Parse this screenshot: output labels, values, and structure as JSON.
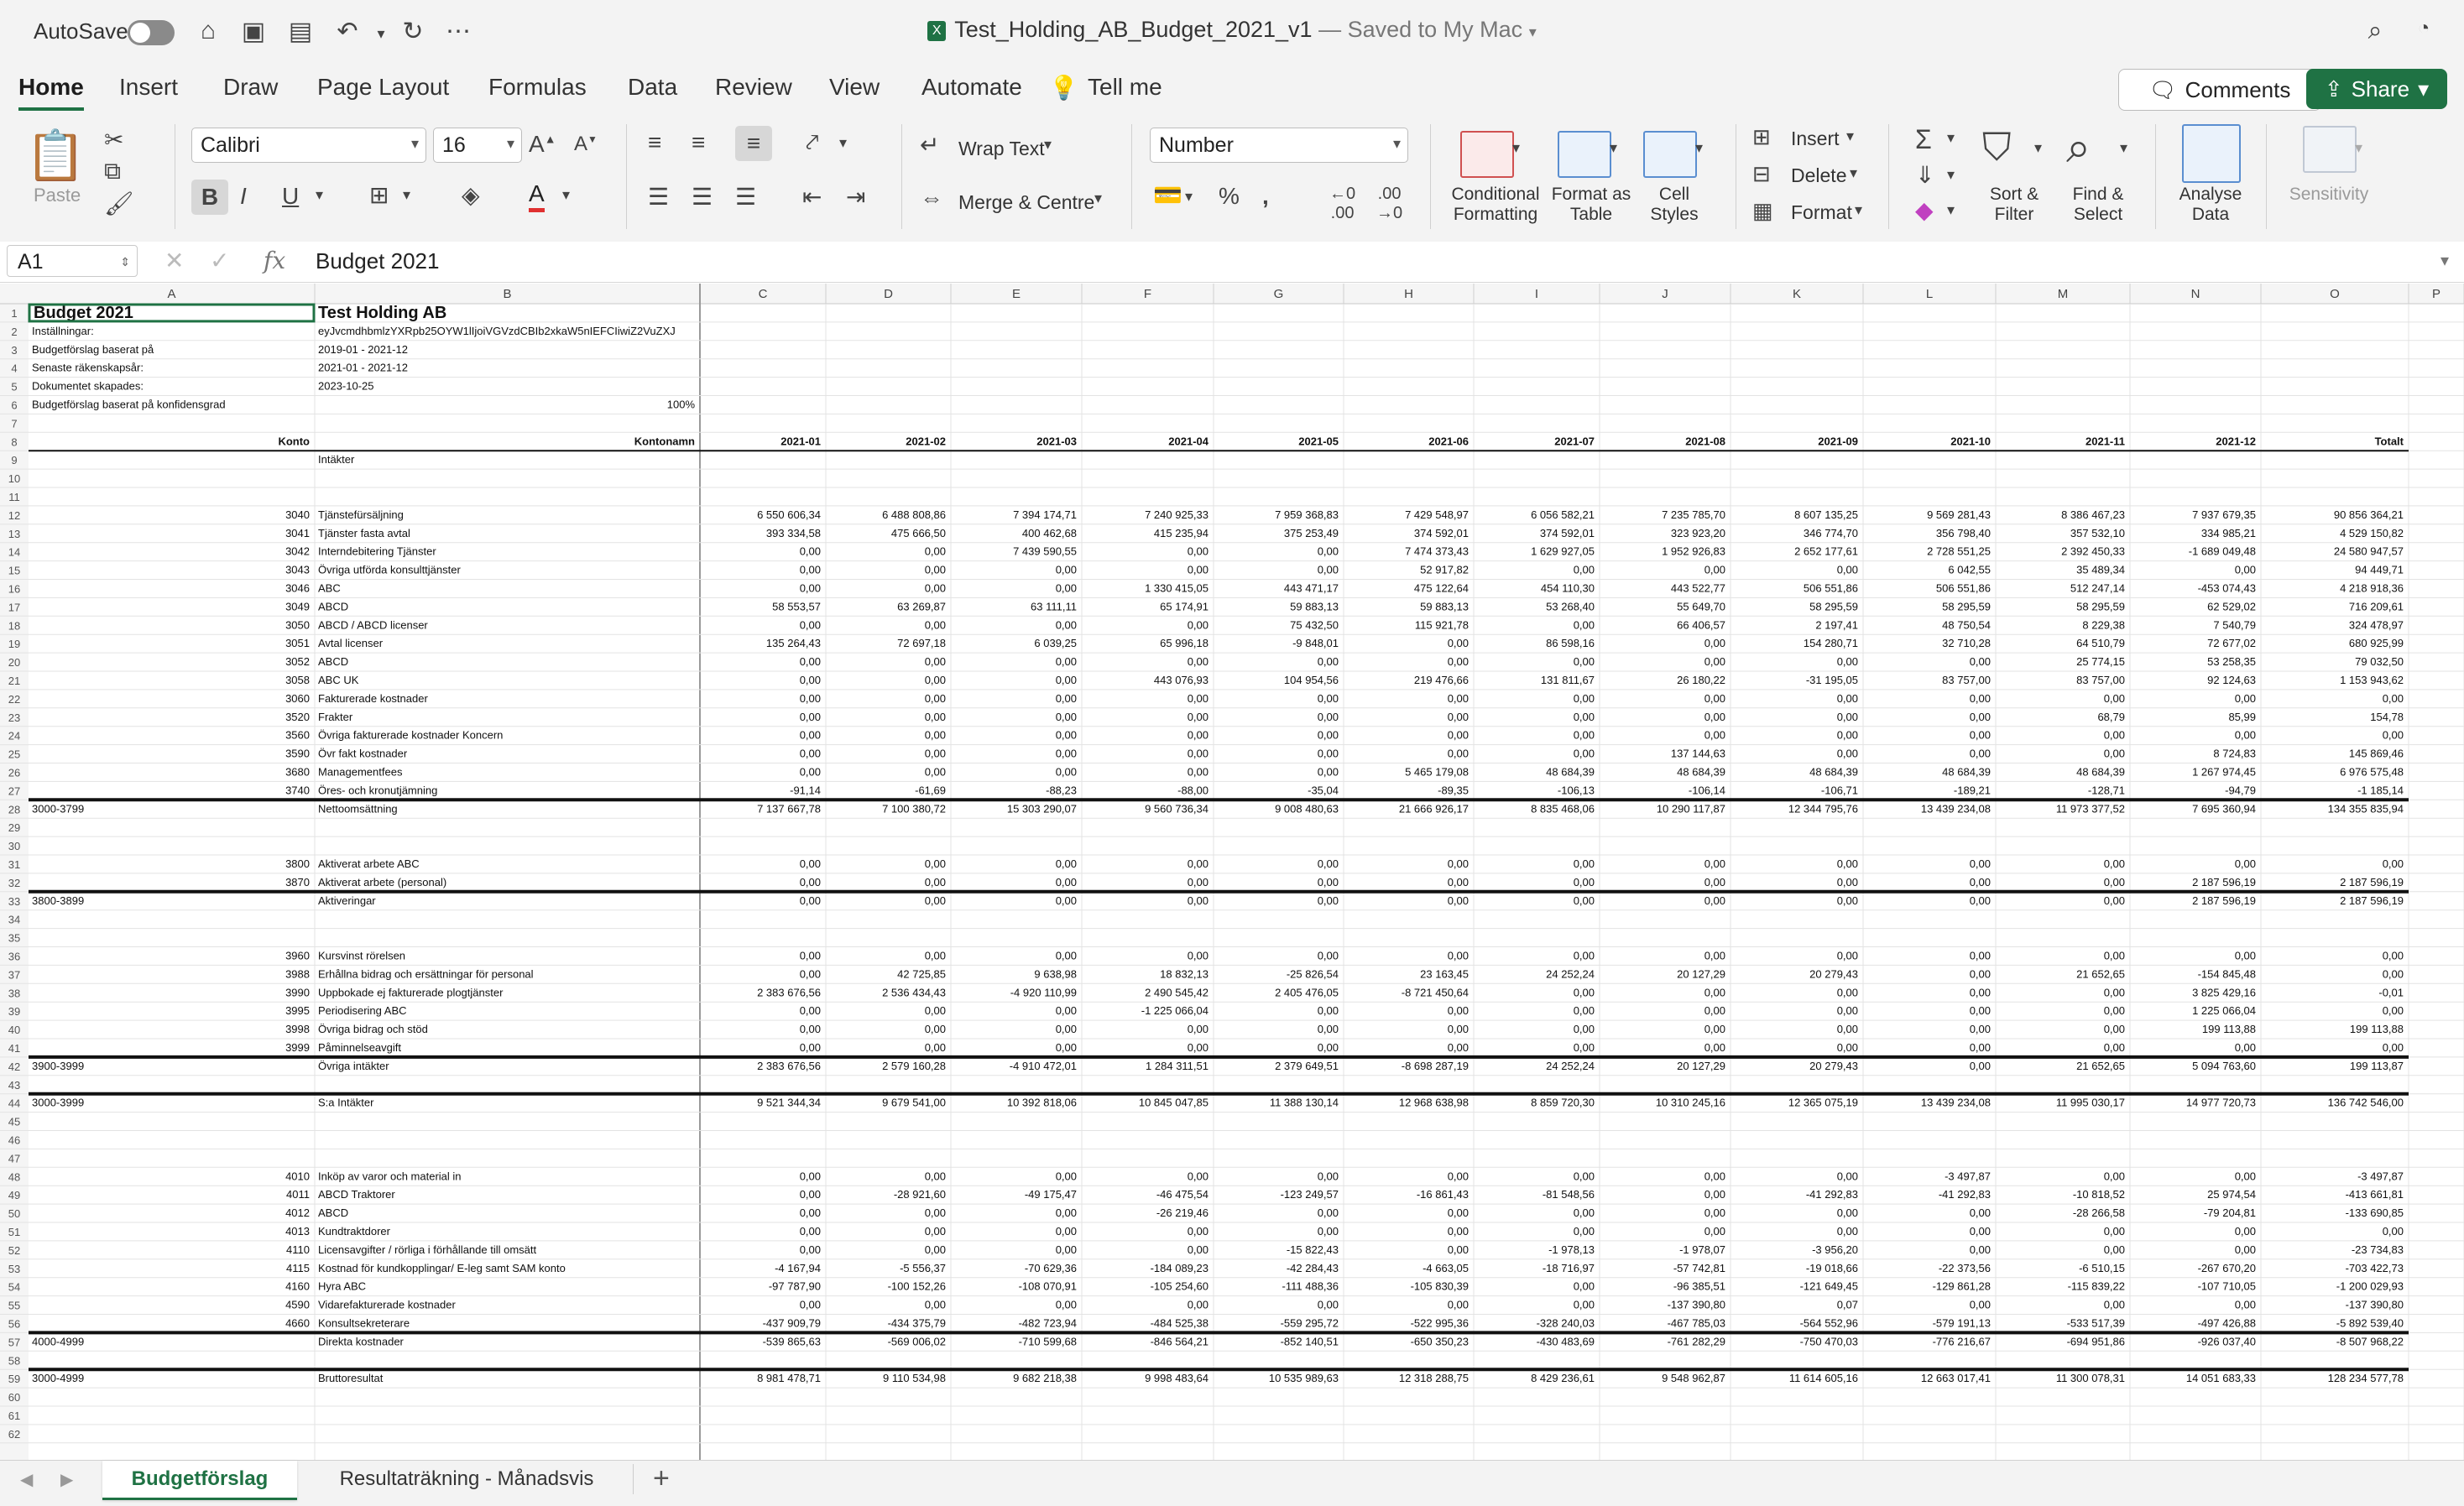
{
  "window": {
    "autosave_label": "AutoSave",
    "title": "Test_Holding_AB_Budget_2021_v1",
    "saved_status": "— Saved to My Mac"
  },
  "menu_tabs": [
    "Home",
    "Insert",
    "Draw",
    "Page Layout",
    "Formulas",
    "Data",
    "Review",
    "View",
    "Automate"
  ],
  "tell_me": "Tell me",
  "comments_label": "Comments",
  "share_label": "Share",
  "ribbon": {
    "paste": "Paste",
    "font_name": "Calibri",
    "font_size": "16",
    "wrap_text": "Wrap Text",
    "merge_center": "Merge & Centre",
    "number_format": "Number",
    "conditional_formatting": "Conditional Formatting",
    "format_as_table": "Format as Table",
    "cell_styles": "Cell Styles",
    "insert": "Insert",
    "delete": "Delete",
    "format": "Format",
    "sort_filter": "Sort & Filter",
    "find_select": "Find & Select",
    "analyse_data": "Analyse Data",
    "sensitivity": "Sensitivity"
  },
  "formula_bar": {
    "cell_ref": "A1",
    "content": "Budget 2021"
  },
  "columns": [
    "A",
    "B",
    "C",
    "D",
    "E",
    "F",
    "G",
    "H",
    "I",
    "J",
    "K",
    "L",
    "M",
    "N",
    "O",
    "P"
  ],
  "sheet": {
    "title": "Budget 2021",
    "company": "Test Holding AB",
    "info_rows": [
      [
        "Inställningar:",
        "eyJvcmdhbmlzYXRpb25OYW1lIjoiVGVzdCBIb2xkaW5nIEFCIiwiZ2VuZXJ"
      ],
      [
        "Budgetförslag baserat på",
        "2019-01 - 2021-12"
      ],
      [
        "Senaste räkenskapsår:",
        "2021-01 - 2021-12"
      ],
      [
        "Dokumentet skapades:",
        "2023-10-25"
      ],
      [
        "Budgetförslag baserat på konfidensgrad",
        "100%"
      ]
    ],
    "header": [
      "Konto",
      "Kontonamn",
      "2021-01",
      "2021-02",
      "2021-03",
      "2021-04",
      "2021-05",
      "2021-06",
      "2021-07",
      "2021-08",
      "2021-09",
      "2021-10",
      "2021-11",
      "2021-12",
      "Totalt"
    ],
    "rows": [
      {
        "n": 9,
        "b": "Intäkter"
      },
      {
        "n": 10
      },
      {
        "n": 11
      },
      {
        "n": 12,
        "a": "3040",
        "b": "Tjänstefürsäljning",
        "v": [
          "6 550 606,34",
          "6 488 808,86",
          "7 394 174,71",
          "7 240 925,33",
          "7 959 368,83",
          "7 429 548,97",
          "6 056 582,21",
          "7 235 785,70",
          "8 607 135,25",
          "9 569 281,43",
          "8 386 467,23",
          "7 937 679,35",
          "90 856 364,21"
        ]
      },
      {
        "n": 13,
        "a": "3041",
        "b": "Tjänster fasta avtal",
        "v": [
          "393 334,58",
          "475 666,50",
          "400 462,68",
          "415 235,94",
          "375 253,49",
          "374 592,01",
          "374 592,01",
          "323 923,20",
          "346 774,70",
          "356 798,40",
          "357 532,10",
          "334 985,21",
          "4 529 150,82"
        ]
      },
      {
        "n": 14,
        "a": "3042",
        "b": "Interndebitering Tjänster",
        "v": [
          "0,00",
          "0,00",
          "7 439 590,55",
          "0,00",
          "0,00",
          "7 474 373,43",
          "1 629 927,05",
          "1 952 926,83",
          "2 652 177,61",
          "2 728 551,25",
          "2 392 450,33",
          "-1 689 049,48",
          "24 580 947,57"
        ]
      },
      {
        "n": 15,
        "a": "3043",
        "b": "Övriga utförda konsulttjänster",
        "v": [
          "0,00",
          "0,00",
          "0,00",
          "0,00",
          "0,00",
          "52 917,82",
          "0,00",
          "0,00",
          "0,00",
          "6 042,55",
          "35 489,34",
          "0,00",
          "94 449,71"
        ]
      },
      {
        "n": 16,
        "a": "3046",
        "b": "ABC",
        "v": [
          "0,00",
          "0,00",
          "0,00",
          "1 330 415,05",
          "443 471,17",
          "475 122,64",
          "454 110,30",
          "443 522,77",
          "506 551,86",
          "506 551,86",
          "512 247,14",
          "-453 074,43",
          "4 218 918,36"
        ]
      },
      {
        "n": 17,
        "a": "3049",
        "b": "ABCD",
        "v": [
          "58 553,57",
          "63 269,87",
          "63 111,11",
          "65 174,91",
          "59 883,13",
          "59 883,13",
          "53 268,40",
          "55 649,70",
          "58 295,59",
          "58 295,59",
          "58 295,59",
          "62 529,02",
          "716 209,61"
        ]
      },
      {
        "n": 18,
        "a": "3050",
        "b": "ABCD / ABCD licenser",
        "v": [
          "0,00",
          "0,00",
          "0,00",
          "0,00",
          "75 432,50",
          "115 921,78",
          "0,00",
          "66 406,57",
          "2 197,41",
          "48 750,54",
          "8 229,38",
          "7 540,79",
          "324 478,97"
        ]
      },
      {
        "n": 19,
        "a": "3051",
        "b": "Avtal licenser",
        "v": [
          "135 264,43",
          "72 697,18",
          "6 039,25",
          "65 996,18",
          "-9 848,01",
          "0,00",
          "86 598,16",
          "0,00",
          "154 280,71",
          "32 710,28",
          "64 510,79",
          "72 677,02",
          "680 925,99"
        ]
      },
      {
        "n": 20,
        "a": "3052",
        "b": "ABCD",
        "v": [
          "0,00",
          "0,00",
          "0,00",
          "0,00",
          "0,00",
          "0,00",
          "0,00",
          "0,00",
          "0,00",
          "0,00",
          "25 774,15",
          "53 258,35",
          "79 032,50"
        ]
      },
      {
        "n": 21,
        "a": "3058",
        "b": "ABC UK",
        "v": [
          "0,00",
          "0,00",
          "0,00",
          "443 076,93",
          "104 954,56",
          "219 476,66",
          "131 811,67",
          "26 180,22",
          "-31 195,05",
          "83 757,00",
          "83 757,00",
          "92 124,63",
          "1 153 943,62"
        ]
      },
      {
        "n": 22,
        "a": "3060",
        "b": "Fakturerade kostnader",
        "v": [
          "0,00",
          "0,00",
          "0,00",
          "0,00",
          "0,00",
          "0,00",
          "0,00",
          "0,00",
          "0,00",
          "0,00",
          "0,00",
          "0,00",
          "0,00"
        ]
      },
      {
        "n": 23,
        "a": "3520",
        "b": "Frakter",
        "v": [
          "0,00",
          "0,00",
          "0,00",
          "0,00",
          "0,00",
          "0,00",
          "0,00",
          "0,00",
          "0,00",
          "0,00",
          "68,79",
          "85,99",
          "154,78"
        ]
      },
      {
        "n": 24,
        "a": "3560",
        "b": "Övriga fakturerade kostnader Koncern",
        "v": [
          "0,00",
          "0,00",
          "0,00",
          "0,00",
          "0,00",
          "0,00",
          "0,00",
          "0,00",
          "0,00",
          "0,00",
          "0,00",
          "0,00",
          "0,00"
        ]
      },
      {
        "n": 25,
        "a": "3590",
        "b": "Övr fakt kostnader",
        "v": [
          "0,00",
          "0,00",
          "0,00",
          "0,00",
          "0,00",
          "0,00",
          "0,00",
          "137 144,63",
          "0,00",
          "0,00",
          "0,00",
          "8 724,83",
          "145 869,46"
        ]
      },
      {
        "n": 26,
        "a": "3680",
        "b": "Managementfees",
        "v": [
          "0,00",
          "0,00",
          "0,00",
          "0,00",
          "0,00",
          "5 465 179,08",
          "48 684,39",
          "48 684,39",
          "48 684,39",
          "48 684,39",
          "48 684,39",
          "1 267 974,45",
          "6 976 575,48"
        ]
      },
      {
        "n": 27,
        "a": "3740",
        "b": "Öres- och kronutjämning",
        "v": [
          "-91,14",
          "-61,69",
          "-88,23",
          "-88,00",
          "-35,04",
          "-89,35",
          "-106,13",
          "-106,14",
          "-106,71",
          "-189,21",
          "-128,71",
          "-94,79",
          "-1 185,14"
        ]
      },
      {
        "n": 28,
        "a": "3000-3799",
        "b": "Nettoomsättning",
        "total": true,
        "v": [
          "7 137 667,78",
          "7 100 380,72",
          "15 303 290,07",
          "9 560 736,34",
          "9 008 480,63",
          "21 666 926,17",
          "8 835 468,06",
          "10 290 117,87",
          "12 344 795,76",
          "13 439 234,08",
          "11 973 377,52",
          "7 695 360,94",
          "134 355 835,94"
        ]
      },
      {
        "n": 29
      },
      {
        "n": 30
      },
      {
        "n": 31,
        "a": "3800",
        "b": "Aktiverat arbete ABC",
        "v": [
          "0,00",
          "0,00",
          "0,00",
          "0,00",
          "0,00",
          "0,00",
          "0,00",
          "0,00",
          "0,00",
          "0,00",
          "0,00",
          "0,00",
          "0,00"
        ]
      },
      {
        "n": 32,
        "a": "3870",
        "b": "Aktiverat arbete (personal)",
        "v": [
          "0,00",
          "0,00",
          "0,00",
          "0,00",
          "0,00",
          "0,00",
          "0,00",
          "0,00",
          "0,00",
          "0,00",
          "0,00",
          "2 187 596,19",
          "2 187 596,19"
        ]
      },
      {
        "n": 33,
        "a": "3800-3899",
        "b": "Aktiveringar",
        "total": true,
        "v": [
          "0,00",
          "0,00",
          "0,00",
          "0,00",
          "0,00",
          "0,00",
          "0,00",
          "0,00",
          "0,00",
          "0,00",
          "0,00",
          "2 187 596,19",
          "2 187 596,19"
        ]
      },
      {
        "n": 34
      },
      {
        "n": 35
      },
      {
        "n": 36,
        "a": "3960",
        "b": "Kursvinst rörelsen",
        "v": [
          "0,00",
          "0,00",
          "0,00",
          "0,00",
          "0,00",
          "0,00",
          "0,00",
          "0,00",
          "0,00",
          "0,00",
          "0,00",
          "0,00",
          "0,00"
        ]
      },
      {
        "n": 37,
        "a": "3988",
        "b": "Erhållna bidrag och ersättningar för personal",
        "v": [
          "0,00",
          "42 725,85",
          "9 638,98",
          "18 832,13",
          "-25 826,54",
          "23 163,45",
          "24 252,24",
          "20 127,29",
          "20 279,43",
          "0,00",
          "21 652,65",
          "-154 845,48",
          "0,00"
        ]
      },
      {
        "n": 38,
        "a": "3990",
        "b": "Uppbokade ej fakturerade plogtjänster",
        "v": [
          "2 383 676,56",
          "2 536 434,43",
          "-4 920 110,99",
          "2 490 545,42",
          "2 405 476,05",
          "-8 721 450,64",
          "0,00",
          "0,00",
          "0,00",
          "0,00",
          "0,00",
          "3 825 429,16",
          "-0,01"
        ]
      },
      {
        "n": 39,
        "a": "3995",
        "b": "Periodisering ABC",
        "v": [
          "0,00",
          "0,00",
          "0,00",
          "-1 225 066,04",
          "0,00",
          "0,00",
          "0,00",
          "0,00",
          "0,00",
          "0,00",
          "0,00",
          "1 225 066,04",
          "0,00"
        ]
      },
      {
        "n": 40,
        "a": "3998",
        "b": "Övriga bidrag och stöd",
        "v": [
          "0,00",
          "0,00",
          "0,00",
          "0,00",
          "0,00",
          "0,00",
          "0,00",
          "0,00",
          "0,00",
          "0,00",
          "0,00",
          "199 113,88",
          "199 113,88"
        ]
      },
      {
        "n": 41,
        "a": "3999",
        "b": "Påminnelseavgift",
        "v": [
          "0,00",
          "0,00",
          "0,00",
          "0,00",
          "0,00",
          "0,00",
          "0,00",
          "0,00",
          "0,00",
          "0,00",
          "0,00",
          "0,00",
          "0,00"
        ]
      },
      {
        "n": 42,
        "a": "3900-3999",
        "b": "Övriga intäkter",
        "total": true,
        "v": [
          "2 383 676,56",
          "2 579 160,28",
          "-4 910 472,01",
          "1 284 311,51",
          "2 379 649,51",
          "-8 698 287,19",
          "24 252,24",
          "20 127,29",
          "20 279,43",
          "0,00",
          "21 652,65",
          "5 094 763,60",
          "199 113,87"
        ]
      },
      {
        "n": 43
      },
      {
        "n": 44,
        "a": "3000-3999",
        "b": "S:a Intäkter",
        "total": true,
        "v": [
          "9 521 344,34",
          "9 679 541,00",
          "10 392 818,06",
          "10 845 047,85",
          "11 388 130,14",
          "12 968 638,98",
          "8 859 720,30",
          "10 310 245,16",
          "12 365 075,19",
          "13 439 234,08",
          "11 995 030,17",
          "14 977 720,73",
          "136 742 546,00"
        ]
      },
      {
        "n": 45
      },
      {
        "n": 46
      },
      {
        "n": 47
      },
      {
        "n": 48,
        "a": "4010",
        "b": "Inköp av varor och material in",
        "v": [
          "0,00",
          "0,00",
          "0,00",
          "0,00",
          "0,00",
          "0,00",
          "0,00",
          "0,00",
          "0,00",
          "-3 497,87",
          "0,00",
          "0,00",
          "-3 497,87"
        ]
      },
      {
        "n": 49,
        "a": "4011",
        "b": "ABCD Traktorer",
        "v": [
          "0,00",
          "-28 921,60",
          "-49 175,47",
          "-46 475,54",
          "-123 249,57",
          "-16 861,43",
          "-81 548,56",
          "0,00",
          "-41 292,83",
          "-41 292,83",
          "-10 818,52",
          "25 974,54",
          "-413 661,81"
        ]
      },
      {
        "n": 50,
        "a": "4012",
        "b": "ABCD",
        "v": [
          "0,00",
          "0,00",
          "0,00",
          "-26 219,46",
          "0,00",
          "0,00",
          "0,00",
          "0,00",
          "0,00",
          "0,00",
          "-28 266,58",
          "-79 204,81",
          "-133 690,85"
        ]
      },
      {
        "n": 51,
        "a": "4013",
        "b": "Kundtraktdorer",
        "v": [
          "0,00",
          "0,00",
          "0,00",
          "0,00",
          "0,00",
          "0,00",
          "0,00",
          "0,00",
          "0,00",
          "0,00",
          "0,00",
          "0,00",
          "0,00"
        ]
      },
      {
        "n": 52,
        "a": "4110",
        "b": "Licensavgifter / rörliga i förhållande till omsätt",
        "v": [
          "0,00",
          "0,00",
          "0,00",
          "0,00",
          "-15 822,43",
          "0,00",
          "-1 978,13",
          "-1 978,07",
          "-3 956,20",
          "0,00",
          "0,00",
          "0,00",
          "-23 734,83"
        ]
      },
      {
        "n": 53,
        "a": "4115",
        "b": "Kostnad för kundkopplingar/ E-leg samt SAM konto",
        "v": [
          "-4 167,94",
          "-5 556,37",
          "-70 629,36",
          "-184 089,23",
          "-42 284,43",
          "-4 663,05",
          "-18 716,97",
          "-57 742,81",
          "-19 018,66",
          "-22 373,56",
          "-6 510,15",
          "-267 670,20",
          "-703 422,73"
        ]
      },
      {
        "n": 54,
        "a": "4160",
        "b": "Hyra ABC",
        "v": [
          "-97 787,90",
          "-100 152,26",
          "-108 070,91",
          "-105 254,60",
          "-111 488,36",
          "-105 830,39",
          "0,00",
          "-96 385,51",
          "-121 649,45",
          "-129 861,28",
          "-115 839,22",
          "-107 710,05",
          "-1 200 029,93"
        ]
      },
      {
        "n": 55,
        "a": "4590",
        "b": "Vidarefakturerade kostnader",
        "v": [
          "0,00",
          "0,00",
          "0,00",
          "0,00",
          "0,00",
          "0,00",
          "0,00",
          "-137 390,80",
          "0,07",
          "0,00",
          "0,00",
          "0,00",
          "-137 390,80"
        ]
      },
      {
        "n": 56,
        "a": "4660",
        "b": "Konsultsekreterare",
        "v": [
          "-437 909,79",
          "-434 375,79",
          "-482 723,94",
          "-484 525,38",
          "-559 295,72",
          "-522 995,36",
          "-328 240,03",
          "-467 785,03",
          "-564 552,96",
          "-579 191,13",
          "-533 517,39",
          "-497 426,88",
          "-5 892 539,40"
        ]
      },
      {
        "n": 57,
        "a": "4000-4999",
        "b": "Direkta kostnader",
        "total": true,
        "v": [
          "-539 865,63",
          "-569 006,02",
          "-710 599,68",
          "-846 564,21",
          "-852 140,51",
          "-650 350,23",
          "-430 483,69",
          "-761 282,29",
          "-750 470,03",
          "-776 216,67",
          "-694 951,86",
          "-926 037,40",
          "-8 507 968,22"
        ]
      },
      {
        "n": 58
      },
      {
        "n": 59,
        "a": "3000-4999",
        "b": "Bruttoresultat",
        "total": true,
        "v": [
          "8 981 478,71",
          "9 110 534,98",
          "9 682 218,38",
          "9 998 483,64",
          "10 535 989,63",
          "12 318 288,75",
          "8 429 236,61",
          "9 548 962,87",
          "11 614 605,16",
          "12 663 017,41",
          "11 300 078,31",
          "14 051 683,33",
          "128 234 577,78"
        ]
      },
      {
        "n": 60
      },
      {
        "n": 61
      },
      {
        "n": 62
      }
    ]
  },
  "sheet_tabs": [
    "Budgetförslag",
    "Resultaträkning - Månadsvis"
  ]
}
